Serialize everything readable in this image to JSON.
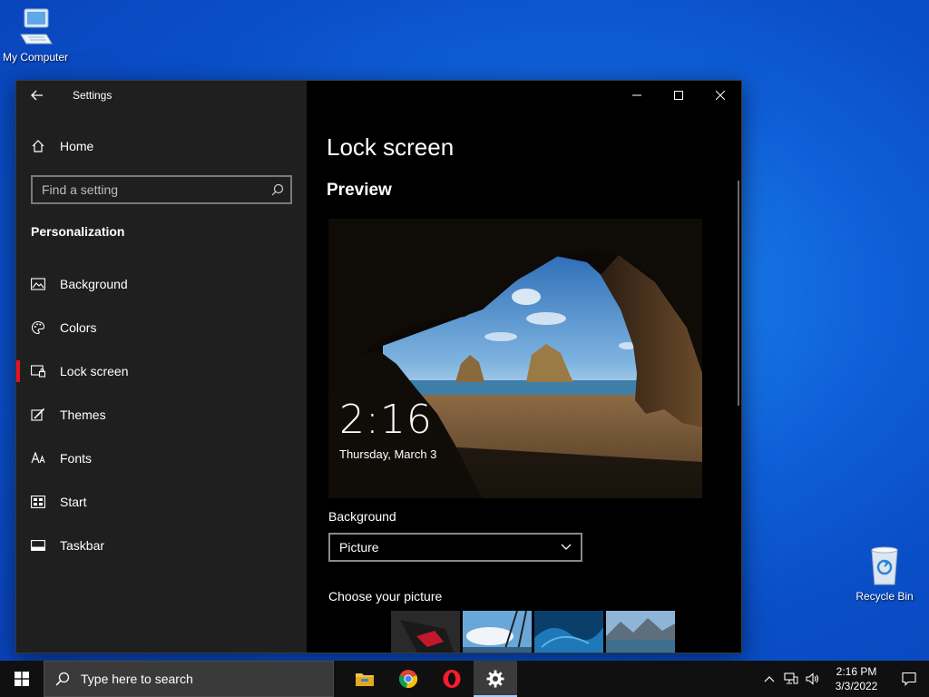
{
  "desktop": {
    "icons": [
      {
        "label": "My Computer",
        "icon": "monitor-icon"
      },
      {
        "label": "Recycle Bin",
        "icon": "recycle-bin-icon"
      }
    ]
  },
  "window": {
    "title": "Settings",
    "controls": [
      "minimize-icon",
      "maximize-icon",
      "close-icon"
    ]
  },
  "sidebar": {
    "home_label": "Home",
    "search_placeholder": "Find a setting",
    "section": "Personalization",
    "items": [
      {
        "label": "Background",
        "icon": "picture-icon"
      },
      {
        "label": "Colors",
        "icon": "palette-icon"
      },
      {
        "label": "Lock screen",
        "icon": "lock-screen-icon",
        "active": true
      },
      {
        "label": "Themes",
        "icon": "brush-icon"
      },
      {
        "label": "Fonts",
        "icon": "font-icon"
      },
      {
        "label": "Start",
        "icon": "start-menu-icon"
      },
      {
        "label": "Taskbar",
        "icon": "taskbar-icon"
      }
    ],
    "active_indicator_color": "#e81123"
  },
  "main": {
    "title": "Lock screen",
    "preview_heading": "Preview",
    "preview_time": "2:16",
    "preview_date": "Thursday, March 3",
    "background_label": "Background",
    "background_value": "Picture",
    "choose_label": "Choose your picture"
  },
  "taskbar": {
    "search_placeholder": "Type here to search",
    "apps": [
      "file-explorer-icon",
      "chrome-icon",
      "opera-icon",
      "settings-gear-icon"
    ],
    "active_app": "settings-gear-icon",
    "time": "2:16 PM",
    "date": "3/3/2022",
    "tray": [
      "chevron-up-icon",
      "network-icon",
      "volume-icon",
      "notification-icon"
    ]
  },
  "colors": {
    "accent": "#0078d7",
    "sidebar_bg": "#1f1f1f",
    "content_bg": "#000000",
    "taskbar_bg": "#101010"
  }
}
